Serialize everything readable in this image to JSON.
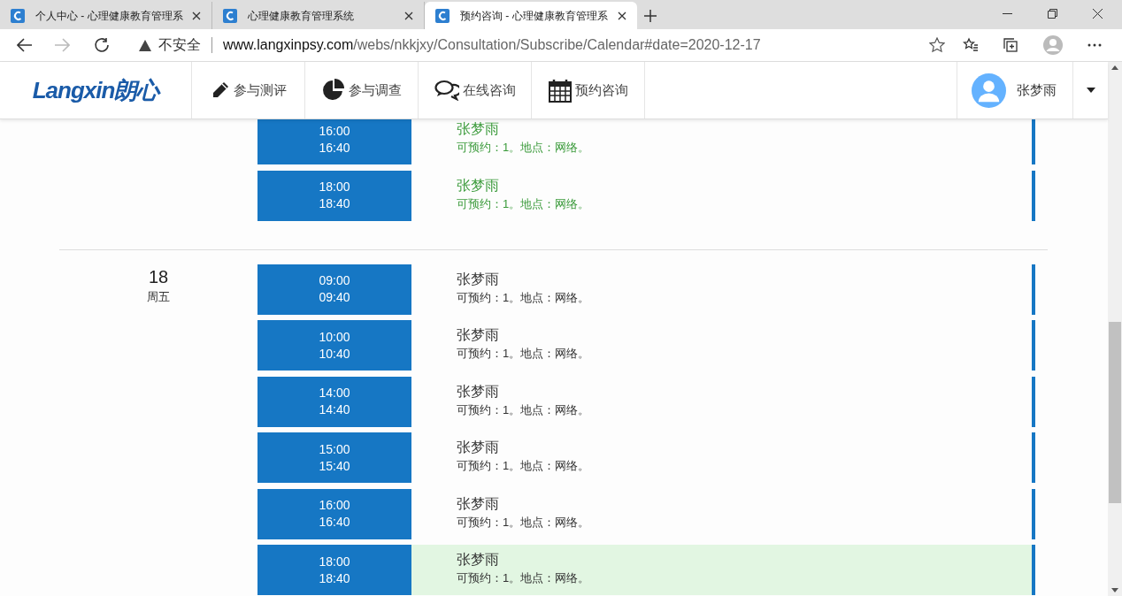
{
  "browser": {
    "tabs": [
      {
        "title": "个人中心 - 心理健康教育管理系",
        "selected": false
      },
      {
        "title": "心理健康教育管理系统",
        "selected": false
      },
      {
        "title": "预约咨询 - 心理健康教育管理系",
        "selected": true
      }
    ],
    "security": "不安全",
    "url": "www.langxinpsy.com/webs/nkkjxy/Consultation/Subscribe/Calendar#date=2020-12-17"
  },
  "navbar": {
    "logo": "Langxin朗心",
    "items": [
      {
        "kind": "pencil",
        "label": "参与测评"
      },
      {
        "kind": "pie",
        "label": "参与调查"
      },
      {
        "kind": "chat",
        "label": "在线咨询"
      },
      {
        "kind": "calendar",
        "label": "预约咨询"
      }
    ],
    "user": "张梦雨"
  },
  "days": [
    {
      "highlighted": true,
      "slots": [
        {
          "start": "16:00",
          "end": "16:40",
          "name": "张梦雨",
          "info": "可预约：1。地点：网络。",
          "selected": false
        },
        {
          "start": "18:00",
          "end": "18:40",
          "name": "张梦雨",
          "info": "可预约：1。地点：网络。",
          "selected": false
        }
      ]
    },
    {
      "day": "18",
      "weekday": "周五",
      "highlighted": false,
      "slots": [
        {
          "start": "09:00",
          "end": "09:40",
          "name": "张梦雨",
          "info": "可预约：1。地点：网络。",
          "selected": false
        },
        {
          "start": "10:00",
          "end": "10:40",
          "name": "张梦雨",
          "info": "可预约：1。地点：网络。",
          "selected": false
        },
        {
          "start": "14:00",
          "end": "14:40",
          "name": "张梦雨",
          "info": "可预约：1。地点：网络。",
          "selected": false
        },
        {
          "start": "15:00",
          "end": "15:40",
          "name": "张梦雨",
          "info": "可预约：1。地点：网络。",
          "selected": false
        },
        {
          "start": "16:00",
          "end": "16:40",
          "name": "张梦雨",
          "info": "可预约：1。地点：网络。",
          "selected": false
        },
        {
          "start": "18:00",
          "end": "18:40",
          "name": "张梦雨",
          "info": "可预约：1。地点：网络。",
          "selected": true
        }
      ]
    }
  ]
}
